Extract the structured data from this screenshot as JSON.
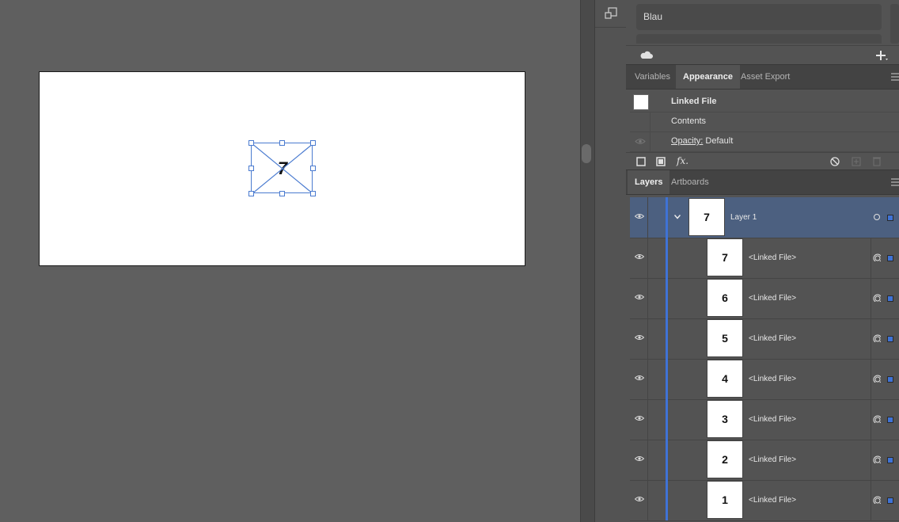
{
  "swatch_field": {
    "value": "Blau"
  },
  "appearance_tabs": [
    {
      "label": "Variables"
    },
    {
      "label": "Appearance"
    },
    {
      "label": "Asset Export"
    }
  ],
  "appearance": {
    "object_type": "Linked File",
    "contents_label": "Contents",
    "opacity_label": "Opacity:",
    "opacity_value": "Default",
    "fx_label": "fx."
  },
  "layer_tabs": [
    {
      "label": "Layers"
    },
    {
      "label": "Artboards"
    }
  ],
  "layers": {
    "parent": {
      "name": "Layer 1",
      "thumb": "7"
    },
    "items": [
      {
        "name": "<Linked File>",
        "thumb": "7"
      },
      {
        "name": "<Linked File>",
        "thumb": "6"
      },
      {
        "name": "<Linked File>",
        "thumb": "5"
      },
      {
        "name": "<Linked File>",
        "thumb": "4"
      },
      {
        "name": "<Linked File>",
        "thumb": "3"
      },
      {
        "name": "<Linked File>",
        "thumb": "2"
      },
      {
        "name": "<Linked File>",
        "thumb": "1"
      }
    ]
  },
  "canvas": {
    "placed_preview": "7"
  },
  "colors": {
    "selection": "#3f73d6",
    "panel_bg": "#535353",
    "canvas_bg": "#5f5f5f"
  }
}
